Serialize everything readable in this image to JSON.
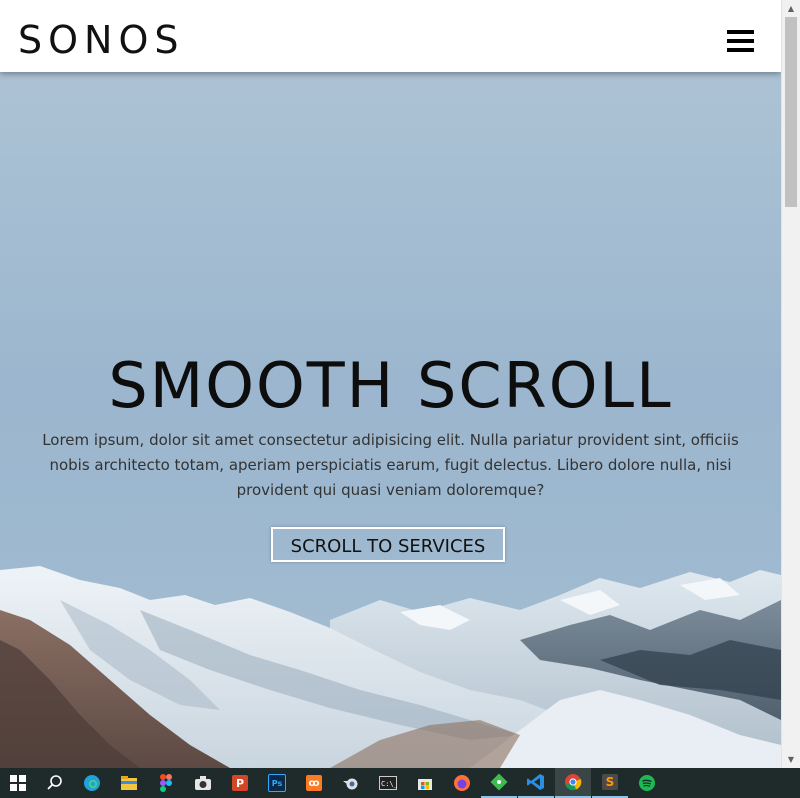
{
  "header": {
    "logo": "SONOS",
    "menu_icon": "hamburger-menu-icon"
  },
  "hero": {
    "title": "SMOOTH SCROLL",
    "text": "Lorem ipsum, dolor sit amet consectetur adipisicing elit. Nulla pariatur provident sint, officiis nobis architecto totam, aperiam perspiciatis earum, fugit delectus. Libero dolore nulla, nisi provident qui quasi veniam doloremque?",
    "button_label": "SCROLL TO SERVICES"
  },
  "taskbar": {
    "items": [
      {
        "name": "windows-start-icon",
        "color": "#ffffff"
      },
      {
        "name": "search-icon",
        "color": "#ffffff"
      },
      {
        "name": "edge-browser-icon",
        "color": "#1fa3d8"
      },
      {
        "name": "file-explorer-icon",
        "color": "#f4c542"
      },
      {
        "name": "figma-icon",
        "color": "#f24e1e"
      },
      {
        "name": "camera-icon",
        "color": "#e6e6e6"
      },
      {
        "name": "powerpoint-icon",
        "color": "#d24726"
      },
      {
        "name": "photoshop-icon",
        "color": "#0a2a4a"
      },
      {
        "name": "xampp-icon",
        "color": "#fb7a24"
      },
      {
        "name": "blender-icon",
        "color": "#e0e0e0"
      },
      {
        "name": "command-prompt-icon",
        "color": "#222222"
      },
      {
        "name": "microsoft-store-icon",
        "color": "#e8e8e8"
      },
      {
        "name": "firefox-icon",
        "color": "#ff7139"
      },
      {
        "name": "git-icon",
        "color": "#3fb950"
      },
      {
        "name": "vscode-icon",
        "color": "#2a8fe0"
      },
      {
        "name": "chrome-icon",
        "color": "#4caf50"
      },
      {
        "name": "sublime-text-icon",
        "color": "#ff9800"
      },
      {
        "name": "spotify-icon",
        "color": "#1db954"
      }
    ]
  }
}
